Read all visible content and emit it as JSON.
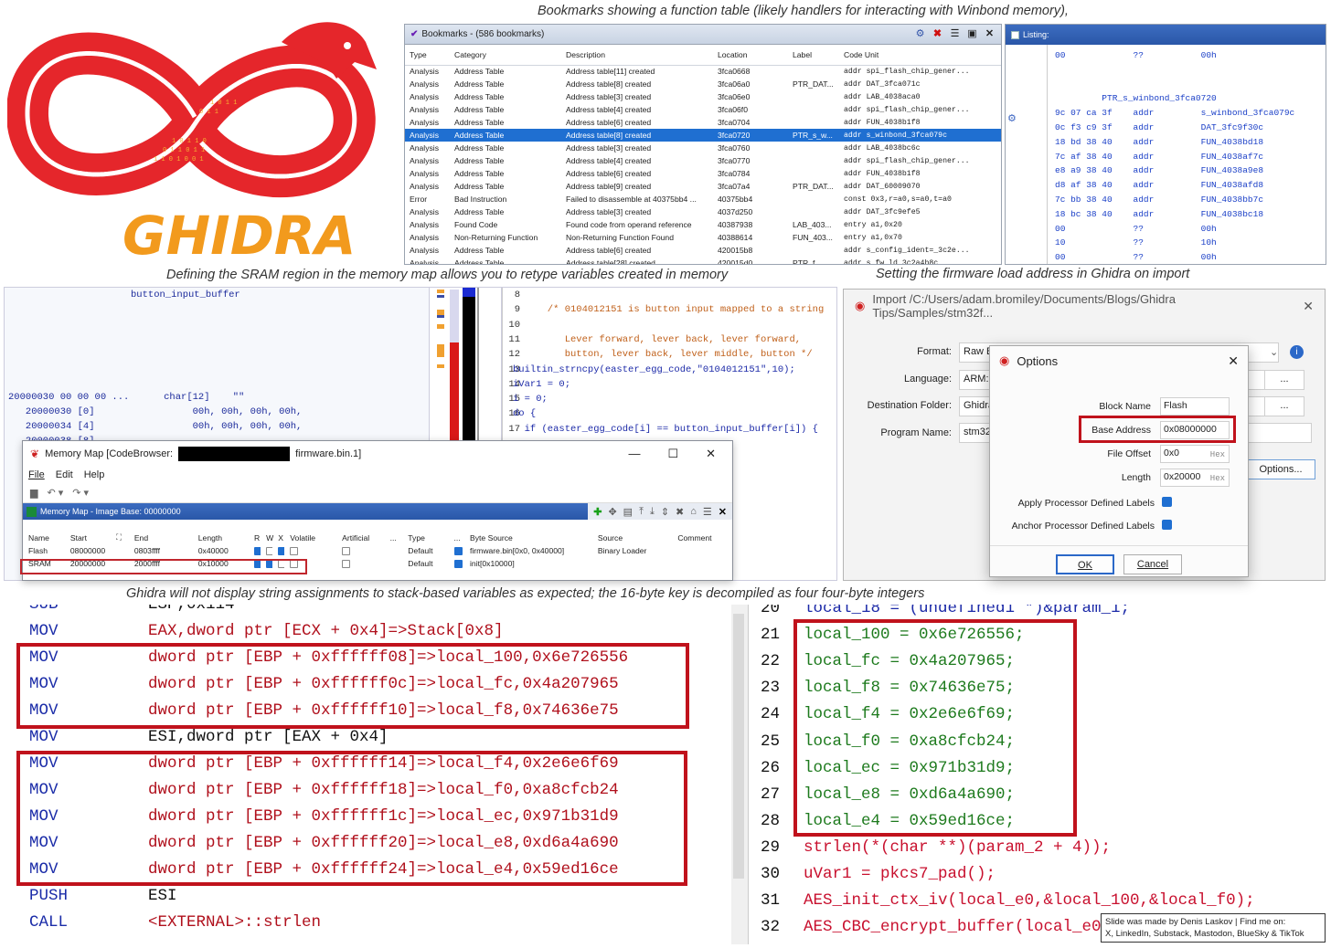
{
  "captions": {
    "bookmarks": "Bookmarks showing a function table (likely handlers for interacting with Winbond memory),",
    "sram": "Defining the SRAM region in the memory map allows you to retype variables created in memory",
    "import": "Setting the firmware load address in Ghidra on import",
    "stack": "Ghidra will not display string assignments to stack-based variables as expected; the 16-byte key is decompiled as four four-byte integers"
  },
  "logo": {
    "text": "GHIDRA",
    "colors": {
      "ring": "#e5262b",
      "text": "#f29a1d",
      "binary": "#f6b233"
    }
  },
  "bookmarks": {
    "title": "Bookmarks - (586 bookmarks)",
    "columns": [
      "Type",
      "Category",
      "Description",
      "Location",
      "",
      "Label",
      "Code Unit"
    ],
    "rows": [
      [
        "Analysis",
        "Address Table",
        "Address table[11] created",
        "3fca0668",
        "",
        "",
        "addr spi_flash_chip_gener..."
      ],
      [
        "Analysis",
        "Address Table",
        "Address table[8] created",
        "3fca06a0",
        "",
        "PTR_DAT...",
        "addr DAT_3fca071c"
      ],
      [
        "Analysis",
        "Address Table",
        "Address table[3] created",
        "3fca06e0",
        "",
        "",
        "addr LAB_4038aca0"
      ],
      [
        "Analysis",
        "Address Table",
        "Address table[4] created",
        "3fca06f0",
        "",
        "",
        "addr spi_flash_chip_gener..."
      ],
      [
        "Analysis",
        "Address Table",
        "Address table[6] created",
        "3fca0704",
        "",
        "",
        "addr FUN_4038b1f8"
      ],
      [
        "Analysis",
        "Address Table",
        "Address table[8] created",
        "3fca0720",
        "",
        "PTR_s_w...",
        "addr s_winbond_3fca079c"
      ],
      [
        "Analysis",
        "Address Table",
        "Address table[3] created",
        "3fca0760",
        "",
        "",
        "addr LAB_4038bc6c"
      ],
      [
        "Analysis",
        "Address Table",
        "Address table[4] created",
        "3fca0770",
        "",
        "",
        "addr spi_flash_chip_gener..."
      ],
      [
        "Analysis",
        "Address Table",
        "Address table[6] created",
        "3fca0784",
        "",
        "",
        "addr FUN_4038b1f8"
      ],
      [
        "Analysis",
        "Address Table",
        "Address table[9] created",
        "3fca07a4",
        "",
        "PTR_DAT...",
        "addr DAT_60009070"
      ],
      [
        "Error",
        "Bad Instruction",
        "Failed to disassemble at 40375bb4 ...",
        "40375bb4",
        "",
        "",
        "const 0x3,r=a0,s=a0,t=a0"
      ],
      [
        "Analysis",
        "Address Table",
        "Address table[3] created",
        "4037d250",
        "",
        "",
        "addr DAT_3fc9efe5"
      ],
      [
        "Analysis",
        "Found Code",
        "Found code from operand reference",
        "40387938",
        "",
        "LAB_403...",
        "entry a1,0x20"
      ],
      [
        "Analysis",
        "Non-Returning Function",
        "Non-Returning Function Found",
        "40388614",
        "",
        "FUN_403...",
        "entry a1,0x70"
      ],
      [
        "Analysis",
        "Address Table",
        "Address table[6] created",
        "420015b8",
        "",
        "",
        "addr s_config_ident=_3c2e..."
      ],
      [
        "Analysis",
        "Address Table",
        "Address table[28] created",
        "420015d0",
        "",
        "PTR_f...",
        "addr s_fw_ld_3c2a4b8c"
      ]
    ],
    "selected_row": 5
  },
  "listing": {
    "title": "Listing:",
    "lines": [
      "00             ??           00h",
      "",
      "",
      "         PTR_s_winbond_3fca0720",
      "9c 07 ca 3f    addr         s_winbond_3fca079c",
      "0c f3 c9 3f    addr         DAT_3fc9f30c",
      "18 bd 38 40    addr         FUN_4038bd18",
      "7c af 38 40    addr         FUN_4038af7c",
      "e8 a9 38 40    addr         FUN_4038a9e8",
      "d8 af 38 40    addr         FUN_4038afd8",
      "7c bb 38 40    addr         FUN_4038bb7c",
      "18 bc 38 40    addr         FUN_4038bc18",
      "00             ??           00h",
      "10             ??           10h",
      "00             ??           00h",
      "00             ??           00h"
    ]
  },
  "memview": {
    "label": "button_input_buffer",
    "lines": [
      "20000030 00 00 00 ...      char[12]    \"\"",
      "   20000030 [0]                 00h, 00h, 00h, 00h,",
      "   20000034 [4]                 00h, 00h, 00h, 00h,",
      "   20000038 [8]"
    ]
  },
  "decomp_small": {
    "lines": [
      [
        "8",
        ""
      ],
      [
        "9",
        "      /* 0104012151 is button input mapped to a string"
      ],
      [
        "10",
        ""
      ],
      [
        "11",
        "         Lever forward, lever back, lever forward,"
      ],
      [
        "12",
        "         button, lever back, lever middle, button */"
      ],
      [
        "13",
        "builtin_strncpy(easter_egg_code,\"0104012151\",10);"
      ],
      [
        "14",
        "iVar1 = 0;"
      ],
      [
        "15",
        "i = 0;"
      ],
      [
        "16",
        "do {"
      ],
      [
        "17",
        "  if (easter_egg_code[i] == button_input_buffer[i]) {"
      ]
    ]
  },
  "memmap": {
    "window_title_prefix": "Memory Map [CodeBrowser: ",
    "window_title_suffix": "firmware.bin.1]",
    "menu": [
      "File",
      "Edit",
      "Help"
    ],
    "panel_title": "Memory Map - Image Base: 00000000",
    "columns": [
      "Name",
      "Start",
      "End",
      "Length",
      "R",
      "W",
      "X",
      "Volatile",
      "Artificial",
      "...",
      "Type",
      "...",
      "Byte Source",
      "Source",
      "Comment"
    ],
    "rows": [
      [
        "Flash",
        "08000000",
        "0803ffff",
        "0x40000",
        "on",
        "off",
        "on",
        "off",
        "off",
        "",
        "Default",
        "on",
        "firmware.bin[0x0, 0x40000]",
        "Binary Loader",
        ""
      ],
      [
        "SRAM",
        "20000000",
        "2000ffff",
        "0x10000",
        "on",
        "on",
        "off",
        "off",
        "off",
        "",
        "Default",
        "on",
        "init[0x10000]",
        "",
        ""
      ]
    ]
  },
  "import_dialog": {
    "title": "Import /C:/Users/adam.bromiley/Documents/Blogs/Ghidra Tips/Samples/stm32f...",
    "labels": [
      "Format:",
      "Language:",
      "Destination Folder:",
      "Program Name:"
    ],
    "values": [
      "Raw B",
      "ARM:L",
      "Ghidra",
      "stm32"
    ],
    "dots": "...",
    "options_button": "Options..."
  },
  "options_dialog": {
    "title": "Options",
    "fields": [
      {
        "label": "Block Name",
        "value": "Flash",
        "hex": ""
      },
      {
        "label": "Base Address",
        "value": "0x08000000",
        "hex": ""
      },
      {
        "label": "File Offset",
        "value": "0x0",
        "hex": "Hex"
      },
      {
        "label": "Length",
        "value": "0x20000",
        "hex": "Hex"
      }
    ],
    "checks": [
      "Apply Processor Defined Labels",
      "Anchor Processor Defined Labels"
    ],
    "ok": "OK",
    "cancel": "Cancel"
  },
  "asm": {
    "rows": [
      [
        "SUB",
        "ESP,0x114"
      ],
      [
        "MOV",
        "EAX,dword ptr [ECX + 0x4]=>Stack[0x8]"
      ],
      [
        "MOV",
        "dword ptr [EBP + 0xffffff08]=>local_100,0x6e726556"
      ],
      [
        "MOV",
        "dword ptr [EBP + 0xffffff0c]=>local_fc,0x4a207965"
      ],
      [
        "MOV",
        "dword ptr [EBP + 0xffffff10]=>local_f8,0x74636e75"
      ],
      [
        "MOV",
        "ESI,dword ptr [EAX + 0x4]"
      ],
      [
        "MOV",
        "dword ptr [EBP + 0xffffff14]=>local_f4,0x2e6e6f69"
      ],
      [
        "MOV",
        "dword ptr [EBP + 0xffffff18]=>local_f0,0xa8cfcb24"
      ],
      [
        "MOV",
        "dword ptr [EBP + 0xffffff1c]=>local_ec,0x971b31d9"
      ],
      [
        "MOV",
        "dword ptr [EBP + 0xffffff20]=>local_e8,0xd6a4a690"
      ],
      [
        "MOV",
        "dword ptr [EBP + 0xffffff24]=>local_e4,0x59ed16ce"
      ],
      [
        "PUSH",
        "ESI"
      ],
      [
        "CALL",
        "<EXTERNAL>::strlen"
      ]
    ]
  },
  "cdec": {
    "rows": [
      [
        "20",
        "local_18 = (undefined1 *)&param_1;"
      ],
      [
        "21",
        "local_100 = 0x6e726556;"
      ],
      [
        "22",
        "local_fc = 0x4a207965;"
      ],
      [
        "23",
        "local_f8 = 0x74636e75;"
      ],
      [
        "24",
        "local_f4 = 0x2e6e6f69;"
      ],
      [
        "25",
        "local_f0 = 0xa8cfcb24;"
      ],
      [
        "26",
        "local_ec = 0x971b31d9;"
      ],
      [
        "27",
        "local_e8 = 0xd6a4a690;"
      ],
      [
        "28",
        "local_e4 = 0x59ed16ce;"
      ],
      [
        "29",
        "strlen(*(char **)(param_2 + 4));"
      ],
      [
        "30",
        "uVar1 = pkcs7_pad();"
      ],
      [
        "31",
        "AES_init_ctx_iv(local_e0,&local_100,&local_f0);"
      ],
      [
        "32",
        "AES_CBC_encrypt_buffer(local_e0,"
      ]
    ]
  },
  "credit": {
    "line1": "Slide was made by Denis Laskov | Find me on:",
    "line2": "X, LinkedIn, Substack, Mastodon, BlueSky & TikTok"
  }
}
